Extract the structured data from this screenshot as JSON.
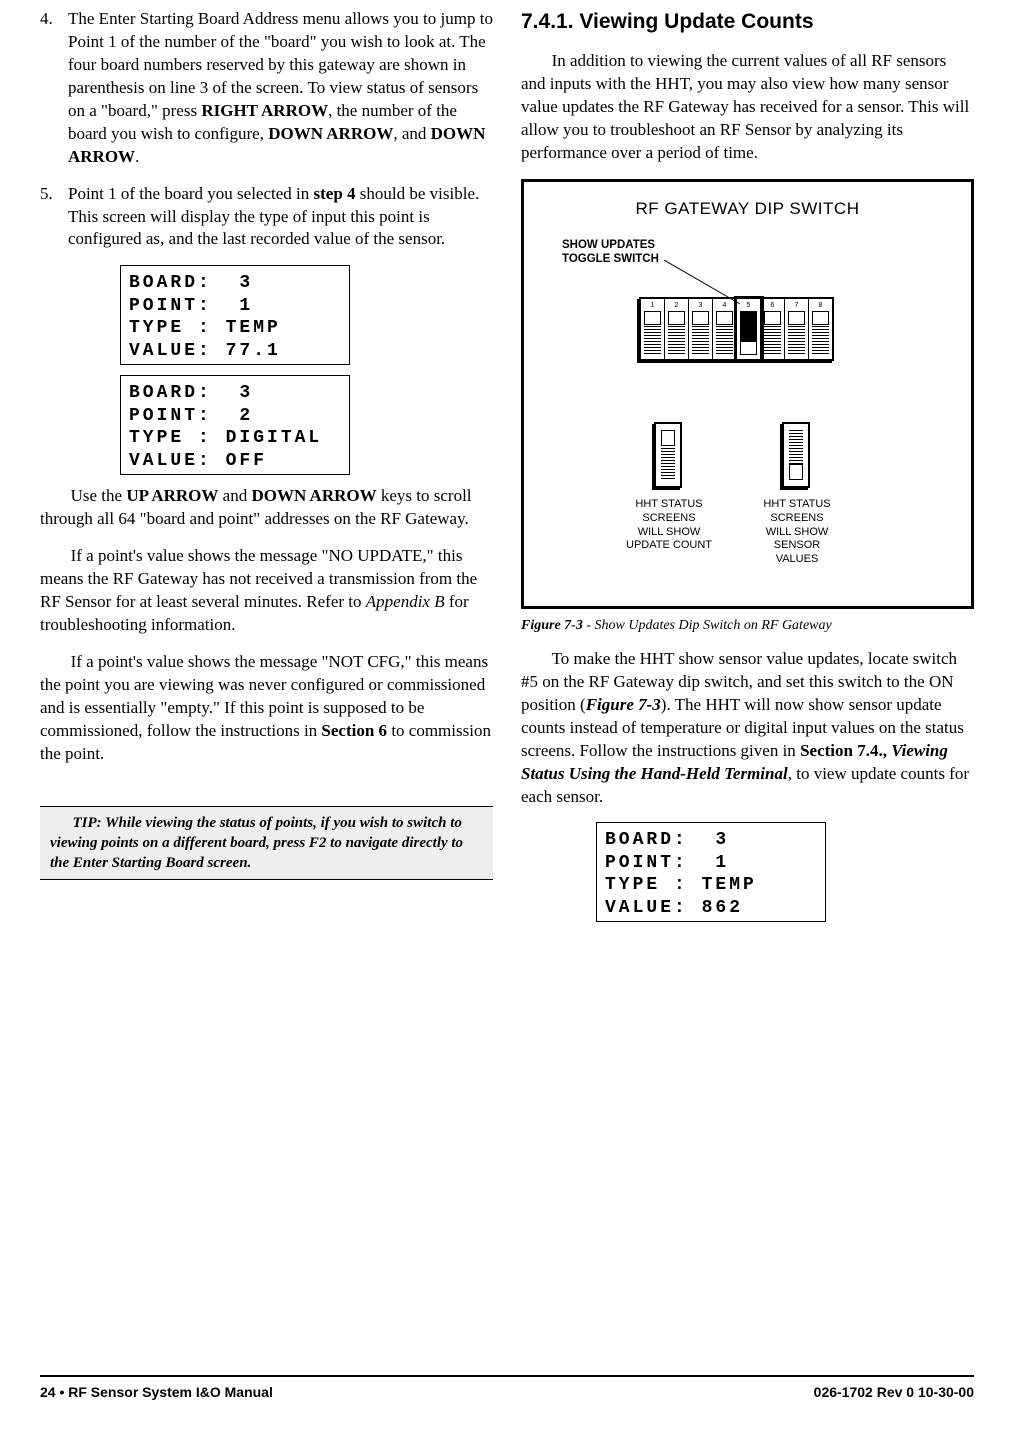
{
  "left": {
    "step4_num": "4.",
    "step4_text_a": "The Enter Starting Board Address menu allows you to jump to Point 1 of the number of the \"board\" you wish to look at. The four board numbers reserved by this gateway are shown in parenthesis on line 3 of the screen. To view status of sensors on a \"board,\" press ",
    "step4_bold1": "RIGHT ARROW",
    "step4_text_b": ", the number of the board you wish to configure, ",
    "step4_bold2": "DOWN ARROW",
    "step4_text_c": ", and ",
    "step4_bold3": "DOWN ARROW",
    "step4_text_d": ".",
    "step5_num": "5.",
    "step5_text_a": "Point 1 of the board you selected in ",
    "step5_bold1": "step 4",
    "step5_text_b": " should be visible. This screen will display the type of input this point is configured as, and the last recorded value of the sensor.",
    "lcd1": "BOARD:  3\nPOINT:  1\nTYPE : TEMP\nVALUE: 77.1",
    "lcd2": "BOARD:  3\nPOINT:  2\nTYPE : DIGITAL\nVALUE: OFF",
    "p1_a": "Use the ",
    "p1_b1": "UP ARROW",
    "p1_b": " and ",
    "p1_b2": "DOWN ARROW",
    "p1_c": " keys to scroll through all 64 \"board and point\" addresses on the RF Gateway.",
    "p2_a": "If a point's value shows the message \"NO UPDATE,\" this means the RF Gateway has not received a transmission from the RF Sensor for at least several minutes. Refer to ",
    "p2_i": "Appendix B",
    "p2_b": " for troubleshooting information.",
    "p3_a": "If a point's value shows the message \"NOT CFG,\" this means the point you are viewing was never configured or commissioned and is essentially \"empty.\" If this point is supposed to be commissioned, follow the instructions in ",
    "p3_b1": "Section 6",
    "p3_b": " to commission the point.",
    "tip": "TIP: While viewing the status of points, if you wish to switch to viewing points on a different board, press F2 to navigate directly to the Enter Starting Board screen."
  },
  "right": {
    "heading": "7.4.1.  Viewing Update Counts",
    "p1": "In addition to viewing the current values of all RF sensors and inputs with the HHT, you may also view how many sensor value updates the RF Gateway has received for a sensor. This will allow you to troubleshoot an RF Sensor by analyzing its performance over a period of time.",
    "fig_title": "RF GATEWAY DIP SWITCH",
    "fig_toggle_label": "SHOW UPDATES\nTOGGLE SWITCH",
    "fig_left_cap": "HHT STATUS\nSCREENS\nWILL SHOW\nUPDATE COUNT",
    "fig_right_cap": "HHT STATUS\nSCREENS\nWILL SHOW\nSENSOR\nVALUES",
    "fig_nums": [
      "1",
      "2",
      "3",
      "4",
      "5",
      "6",
      "7",
      "8"
    ],
    "caption_a": "Figure 7-3",
    "caption_b": " - Show Updates Dip Switch on RF Gateway",
    "p2_a": "To make the HHT show sensor value updates, locate switch #5 on the RF Gateway dip switch, and set this switch to the ON position (",
    "p2_i1": "Figure 7-3",
    "p2_b": "). The HHT will now show sensor update counts instead of temperature or digital input values on the status screens. Follow the instructions given in ",
    "p2_bold": "Section 7.4.,",
    "p2_c": " ",
    "p2_i2": "Viewing Status Using the Hand-Held Terminal",
    "p2_d": ", to view update counts for each sensor.",
    "lcd3": "BOARD:  3\nPOINT:  1\nTYPE : TEMP\nVALUE: 862"
  },
  "footer": {
    "left": "24 • RF Sensor System I&O Manual",
    "right": "026-1702 Rev 0 10-30-00"
  }
}
